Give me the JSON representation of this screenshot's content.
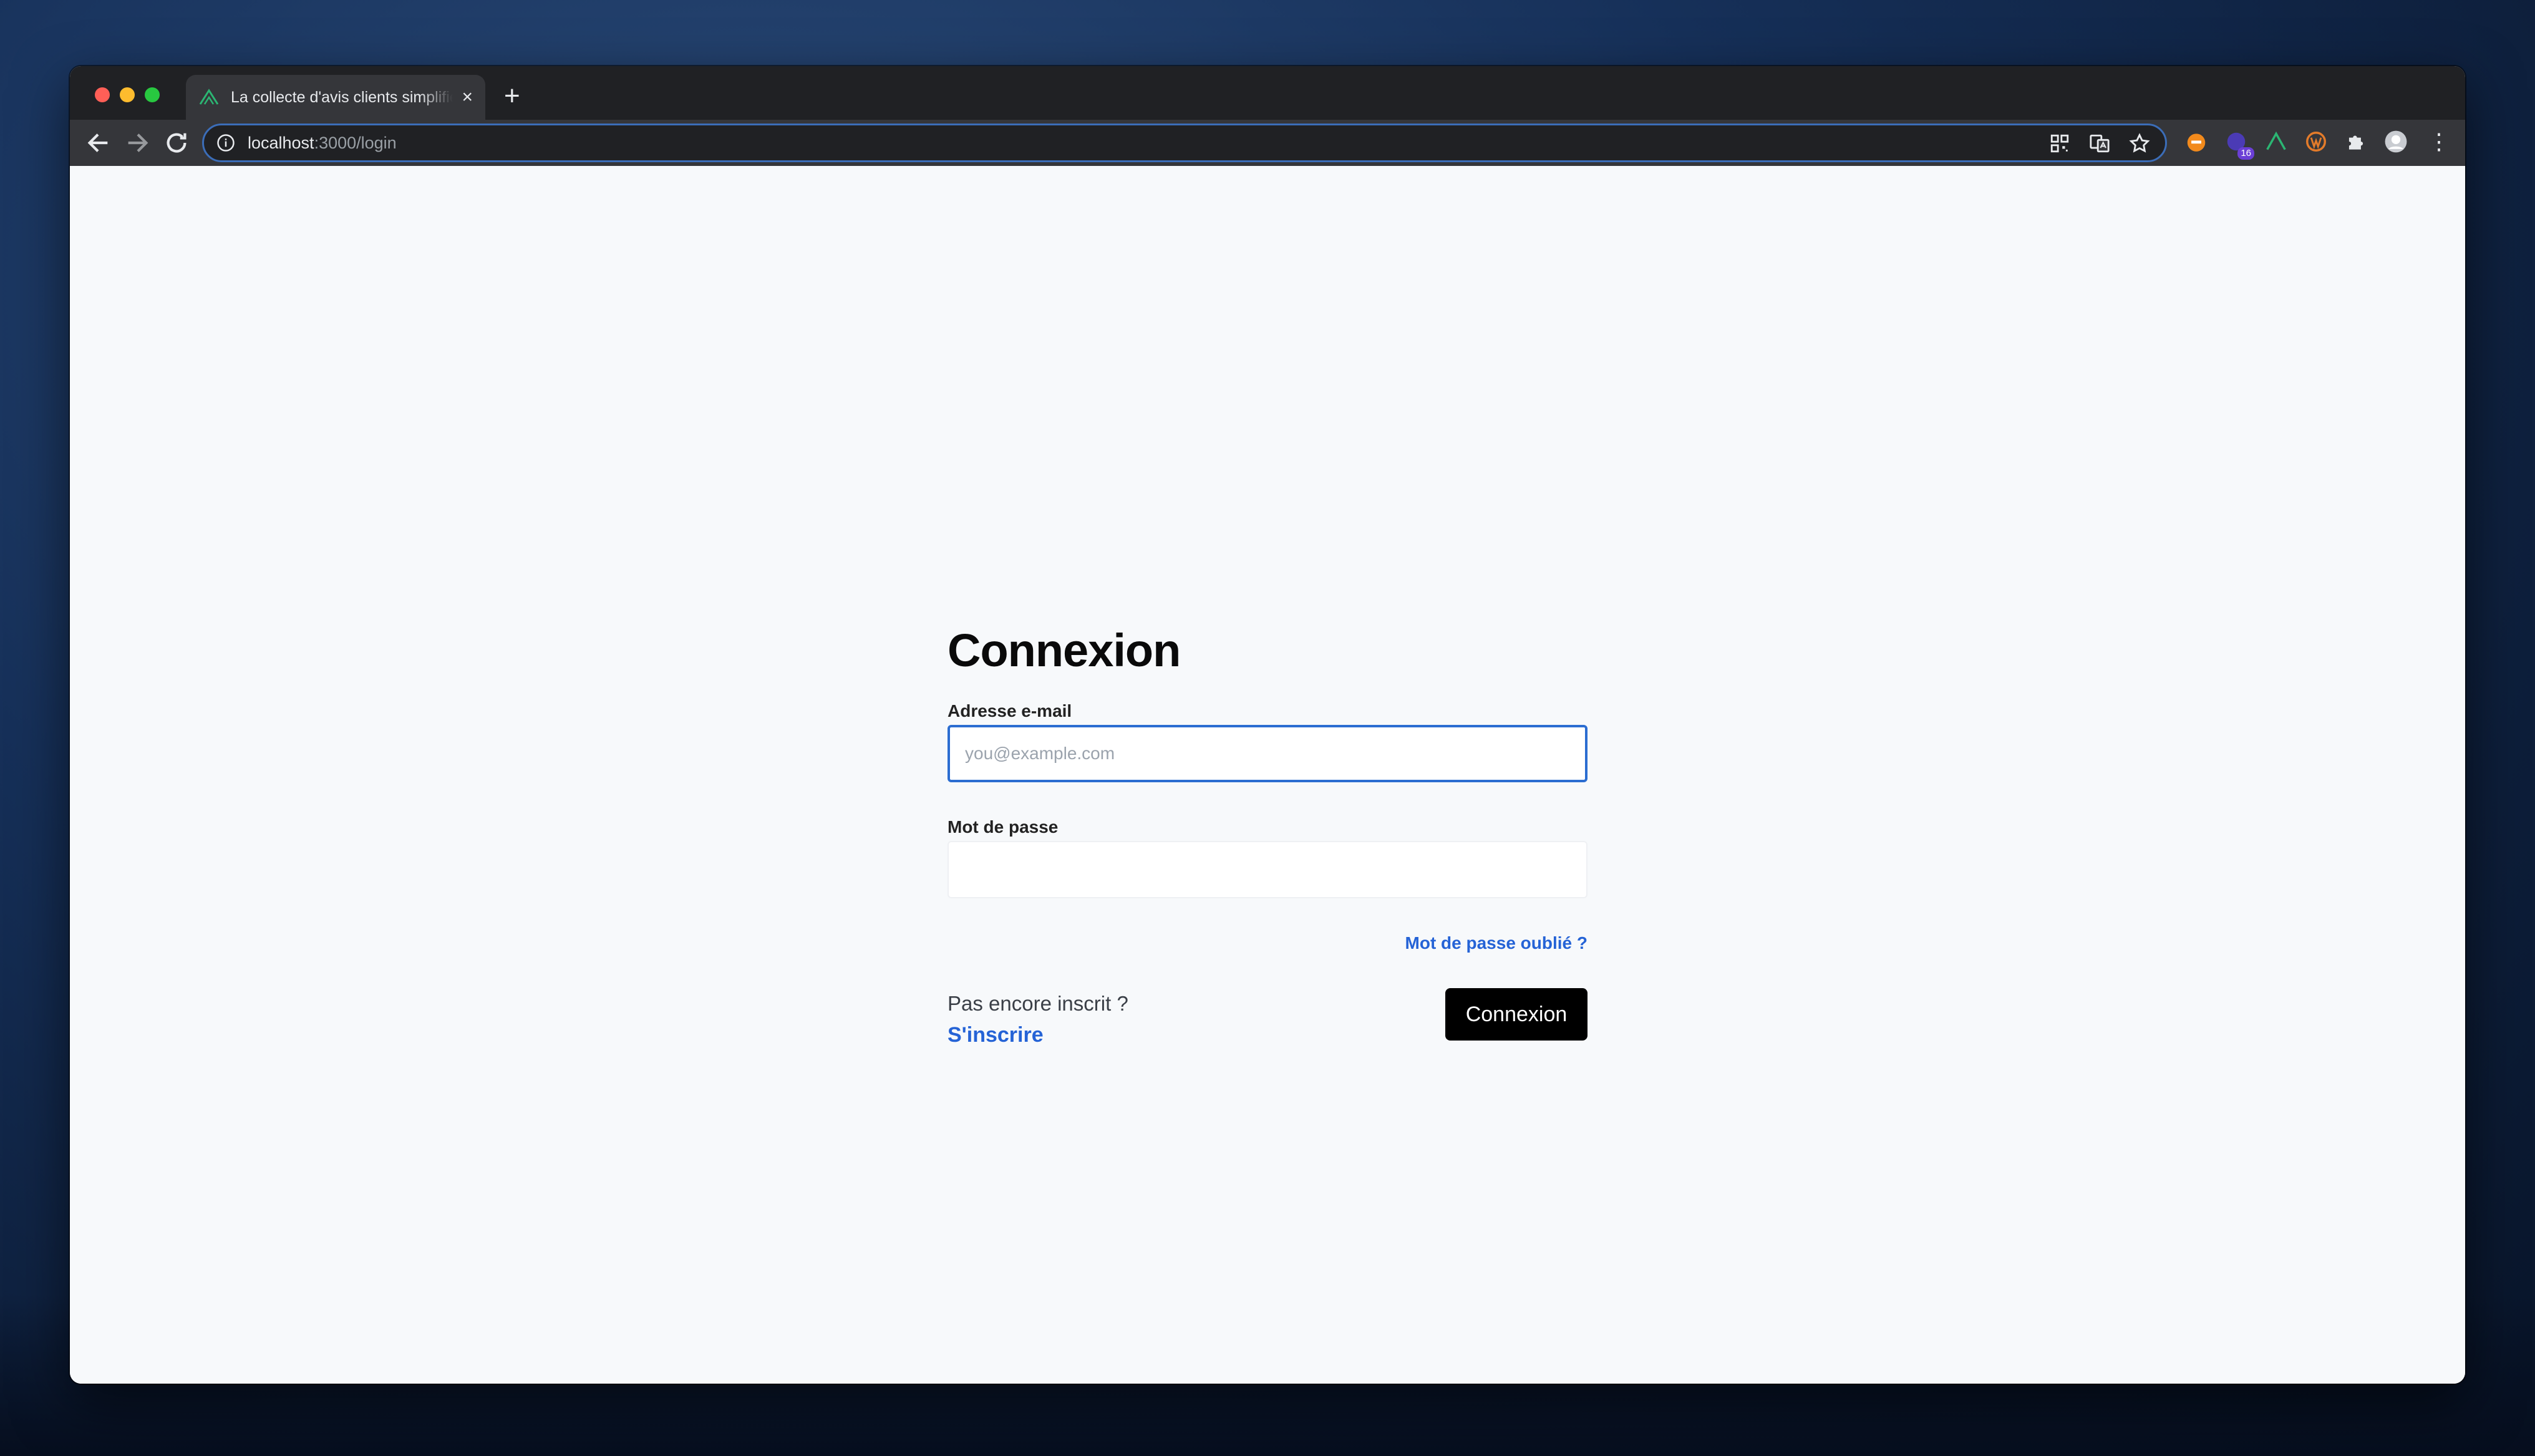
{
  "browser": {
    "tab_title": "La collecte d'avis clients simplifiée",
    "new_tab_symbol": "+",
    "close_symbol": "×",
    "url_host": "localhost",
    "url_path": ":3000/login",
    "extension_badge": "16",
    "menu_symbol": "⋮"
  },
  "login": {
    "title": "Connexion",
    "email_label": "Adresse e-mail",
    "email_placeholder": "you@example.com",
    "email_value": "",
    "password_label": "Mot de passe",
    "password_value": "",
    "forgot_link": "Mot de passe oublié ?",
    "no_account_text": "Pas encore inscrit ?",
    "signup_link": "S'inscrire",
    "submit_label": "Connexion"
  },
  "colors": {
    "accent": "#2563d6",
    "focus_border": "#2b6dd1",
    "button_bg": "#000000",
    "page_bg": "#f7f9fb"
  }
}
